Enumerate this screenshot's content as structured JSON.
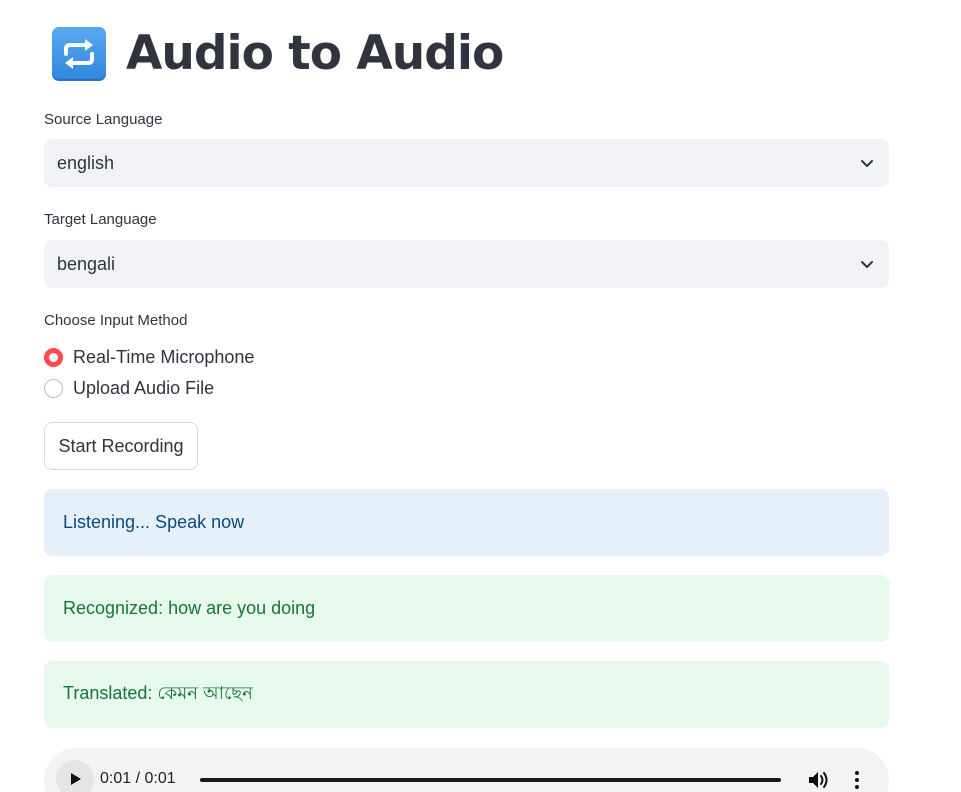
{
  "header": {
    "title": "Audio to Audio",
    "icon": "repeat-arrows-icon",
    "icon_color": "#3b8fe3"
  },
  "source": {
    "label": "Source Language",
    "value": "english"
  },
  "target": {
    "label": "Target Language",
    "value": "bengali"
  },
  "input_method": {
    "label": "Choose Input Method",
    "options": [
      {
        "label": "Real-Time Microphone",
        "selected": true
      },
      {
        "label": "Upload Audio File",
        "selected": false
      }
    ]
  },
  "record_button": {
    "label": "Start Recording"
  },
  "messages": {
    "listening": "Listening... Speak now",
    "recognized": "Recognized: how are you doing",
    "translated": "Translated: কেমন আছেন"
  },
  "player": {
    "current_time": "0:01",
    "separator": " / ",
    "duration": "0:01",
    "progress": 1.0
  },
  "colors": {
    "accent": "#ff4b4b",
    "info_bg": "#e6f0fb",
    "info_text": "#0e4a7b",
    "success_bg": "#e7f8ec",
    "success_text": "#17743a"
  }
}
